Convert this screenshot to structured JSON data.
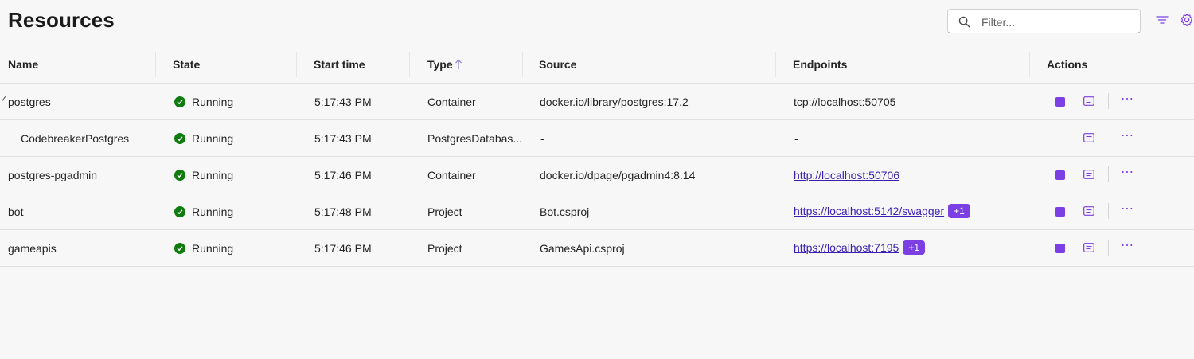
{
  "header": {
    "title": "Resources",
    "filter_placeholder": "Filter..."
  },
  "columns": [
    "Name",
    "State",
    "Start time",
    "Type",
    "Source",
    "Endpoints",
    "Actions"
  ],
  "rows": [
    {
      "name": "postgres",
      "state": "Running",
      "start_time": "5:17:43 PM",
      "type": "Container",
      "source": "docker.io/library/postgres:17.2",
      "endpoint": "tcp://localhost:50705",
      "endpoint_is_link": false,
      "badge": "",
      "has_stop": true,
      "expanded_marker": "✓"
    },
    {
      "name": "CodebreakerPostgres",
      "state": "Running",
      "start_time": "5:17:43 PM",
      "type": "PostgresDatabas...",
      "source": "-",
      "endpoint": "-",
      "endpoint_is_link": false,
      "badge": "",
      "has_stop": false
    },
    {
      "name": "postgres-pgadmin",
      "state": "Running",
      "start_time": "5:17:46 PM",
      "type": "Container",
      "source": "docker.io/dpage/pgadmin4:8.14",
      "endpoint": "http://localhost:50706",
      "endpoint_is_link": true,
      "badge": "",
      "has_stop": true
    },
    {
      "name": "bot",
      "state": "Running",
      "start_time": "5:17:48 PM",
      "type": "Project",
      "source": "Bot.csproj",
      "endpoint": "https://localhost:5142/swagger",
      "endpoint_is_link": true,
      "badge": "+1",
      "has_stop": true
    },
    {
      "name": "gameapis",
      "state": "Running",
      "start_time": "5:17:46 PM",
      "type": "Project",
      "source": "GamesApi.csproj",
      "endpoint": "https://localhost:7195",
      "endpoint_is_link": true,
      "badge": "+1",
      "has_stop": true
    }
  ],
  "icons": {
    "filter": "filter-lines-icon",
    "settings": "gear-icon",
    "search": "search-icon",
    "state_ok": "checkmark-circle-icon",
    "sort": "arrow-up-icon",
    "stop": "stop-icon",
    "console": "console-log-icon",
    "more": "more-horizontal-icon"
  },
  "colors": {
    "accent": "#7b3fe4",
    "running": "#107c10",
    "link": "#3b1fb5"
  }
}
